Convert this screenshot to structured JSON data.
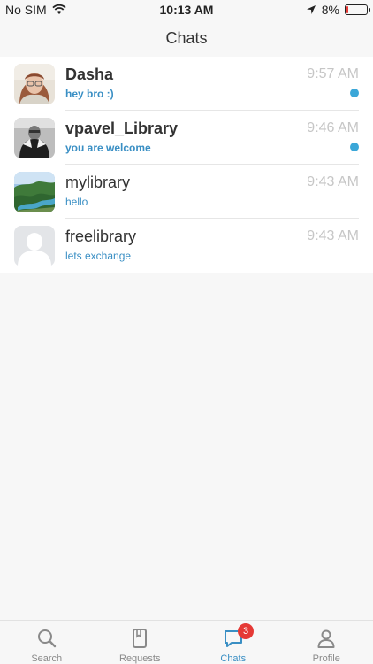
{
  "status_bar": {
    "carrier": "No SIM",
    "time": "10:13 AM",
    "battery": "8%",
    "battery_level": 0.08
  },
  "header": {
    "title": "Chats"
  },
  "chats": [
    {
      "name": "Dasha",
      "time": "9:57 AM",
      "preview": "hey bro :)",
      "unread": true,
      "avatar": "portrait-photo"
    },
    {
      "name": "vpavel_Library",
      "time": "9:46 AM",
      "preview": "you are welcome",
      "unread": true,
      "avatar": "bw-photo"
    },
    {
      "name": "mylibrary",
      "time": "9:43 AM",
      "preview": "hello",
      "unread": false,
      "avatar": "landscape-photo"
    },
    {
      "name": "freelibrary",
      "time": "9:43 AM",
      "preview": "lets exchange",
      "unread": false,
      "avatar": "default-avatar"
    }
  ],
  "tabs": [
    {
      "label": "Search",
      "icon": "search-icon",
      "active": false
    },
    {
      "label": "Requests",
      "icon": "book-icon",
      "active": false
    },
    {
      "label": "Chats",
      "icon": "chat-bubble-icon",
      "active": true,
      "badge": "3"
    },
    {
      "label": "Profile",
      "icon": "person-icon",
      "active": false
    }
  ],
  "colors": {
    "accent": "#3a8fc4",
    "unread_dot": "#3ba7d8",
    "badge": "#e53935",
    "time_text": "#c6c6c6"
  }
}
